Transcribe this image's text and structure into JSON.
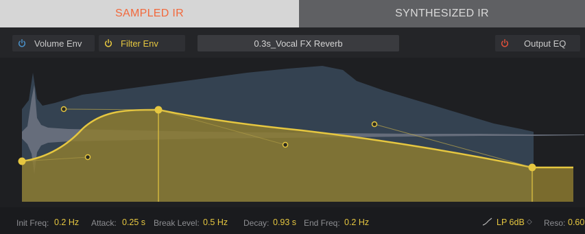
{
  "tabs": {
    "sampled": "SAMPLED IR",
    "synthesized": "SYNTHESIZED IR"
  },
  "toolbar": {
    "volume_env": "Volume Env",
    "filter_env": "Filter Env",
    "preset": "0.3s_Vocal FX Reverb",
    "output_eq": "Output EQ"
  },
  "params": {
    "init_freq_label": "Init Freq:",
    "init_freq": "0.2 Hz",
    "attack_label": "Attack:",
    "attack": "0.25 s",
    "break_level_label": "Break Level:",
    "break_level": "0.5 Hz",
    "decay_label": "Decay:",
    "decay": "0.93 s",
    "end_freq_label": "End Freq:",
    "end_freq": "0.2 Hz",
    "filter_type": "LP 6dB",
    "reso_label": "Reso:",
    "reso": "0.60"
  },
  "colors": {
    "accent": "#f2683b",
    "envelope": "#e6c740",
    "power_blue": "#4a90c8",
    "power_yellow": "#e6c740",
    "power_red": "#e0503a"
  },
  "icons": [
    "power-icon",
    "filter-slope-icon",
    "stepper-icon"
  ]
}
